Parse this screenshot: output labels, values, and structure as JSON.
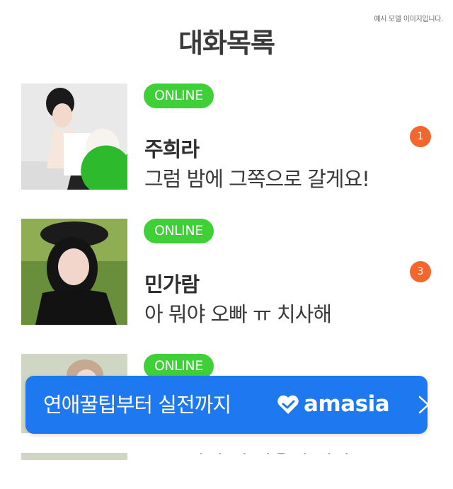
{
  "notice": "예시 모델 이미지입니다.",
  "page_title": "대화목록",
  "chats": [
    {
      "status": "ONLINE",
      "name": "주희라",
      "message": "그럼 밤에 그쪽으로 갈게요!",
      "unread": "1"
    },
    {
      "status": "ONLINE",
      "name": "민가람",
      "message": "아 뭐야 오빠 ㅠ 치사해",
      "unread": "3"
    },
    {
      "status": "ONLINE",
      "name": "",
      "message": "ㅋㅋ 아니 왜 이렇게 재미",
      "unread": ""
    }
  ],
  "banner": {
    "text": "연애꿀팁부터 실전까지",
    "brand": "amasia",
    "arrow_icon": "chevron-right-icon"
  },
  "colors": {
    "online": "#3fcf37",
    "unread": "#f4662b",
    "banner": "#1e78f0"
  }
}
